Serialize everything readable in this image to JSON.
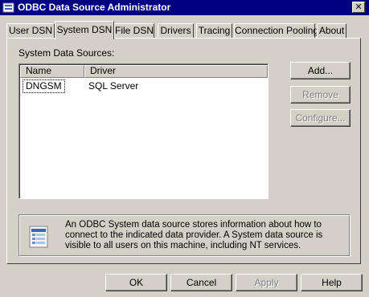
{
  "window": {
    "title": "ODBC Data Source Administrator",
    "close_glyph": "✕"
  },
  "tabs": [
    {
      "label": "User DSN",
      "active": false
    },
    {
      "label": "System DSN",
      "active": true
    },
    {
      "label": "File DSN",
      "active": false
    },
    {
      "label": "Drivers",
      "active": false
    },
    {
      "label": "Tracing",
      "active": false
    },
    {
      "label": "Connection Pooling",
      "active": false
    },
    {
      "label": "About",
      "active": false
    }
  ],
  "panel": {
    "section_label": "System Data Sources:",
    "columns": [
      "Name",
      "Driver"
    ],
    "rows": [
      {
        "name": "DNGSM",
        "driver": "SQL Server"
      }
    ],
    "buttons": {
      "add": "Add...",
      "remove": "Remove",
      "configure": "Configure..."
    },
    "info_icon": "data-source-icon",
    "info_text": "An ODBC System data source stores information about how to connect to the indicated data provider.   A System data source is visible to all users on this machine, including NT services."
  },
  "footer": {
    "ok": "OK",
    "cancel": "Cancel",
    "apply": "Apply",
    "help": "Help"
  },
  "colors": {
    "titlebar": "#000080",
    "face": "#d4d0c8",
    "disabled_text": "#808080"
  }
}
